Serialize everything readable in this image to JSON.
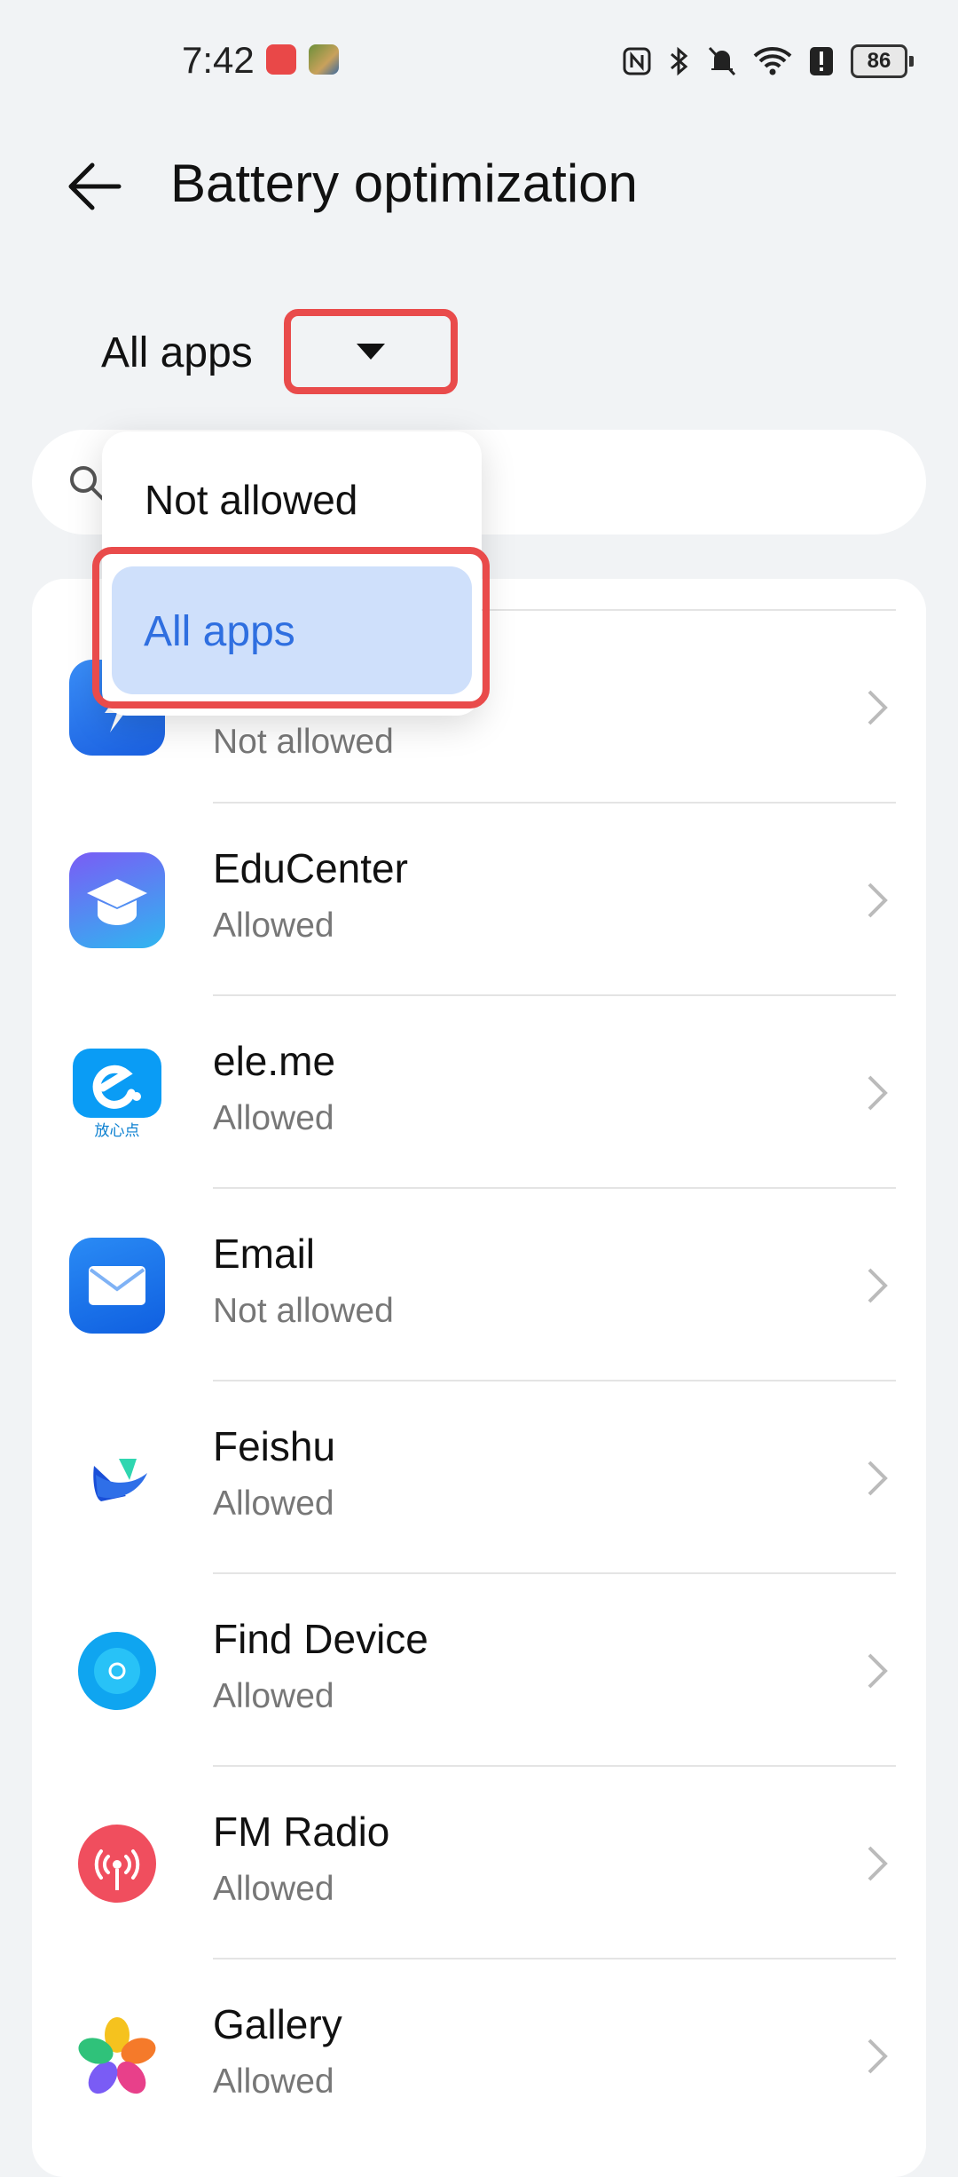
{
  "status_bar": {
    "time": "7:42",
    "battery_level": "86"
  },
  "header": {
    "title": "Battery optimization"
  },
  "filter": {
    "label": "All apps"
  },
  "dropdown": {
    "options": [
      "Not allowed",
      "All apps"
    ],
    "selected": "All apps"
  },
  "apps": [
    {
      "name": "",
      "status": "Not allowed",
      "icon": "power-app-icon"
    },
    {
      "name": "EduCenter",
      "status": "Allowed",
      "icon": "educenter-icon"
    },
    {
      "name": "ele.me",
      "status": "Allowed",
      "icon": "eleme-icon"
    },
    {
      "name": "Email",
      "status": "Not allowed",
      "icon": "email-icon"
    },
    {
      "name": "Feishu",
      "status": "Allowed",
      "icon": "feishu-icon"
    },
    {
      "name": "Find Device",
      "status": "Allowed",
      "icon": "find-device-icon"
    },
    {
      "name": "FM Radio",
      "status": "Allowed",
      "icon": "fm-radio-icon"
    },
    {
      "name": "Gallery",
      "status": "Allowed",
      "icon": "gallery-icon"
    }
  ],
  "eleme_icon_text": "放心点",
  "colors": {
    "accent": "#2f6fe0",
    "highlight": "#e94b4b",
    "selected_bg": "#cfe0fb"
  }
}
